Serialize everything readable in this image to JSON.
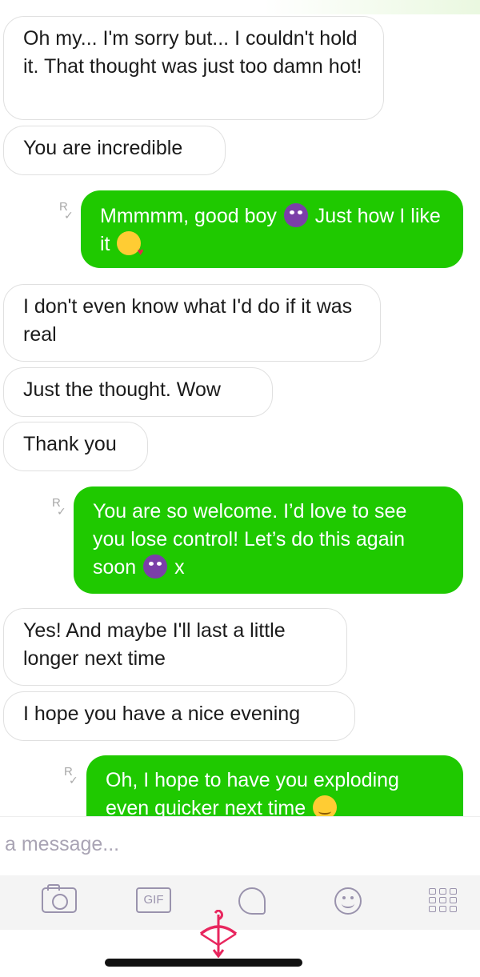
{
  "messages": [
    {
      "direction": "in",
      "text": "Oh my... I'm sorry but... I couldn't hold it. That thought was just too damn hot!"
    },
    {
      "direction": "in",
      "text": "You are incredible"
    },
    {
      "direction": "out",
      "text_1": "Mmmmm, good boy",
      "emoji_1": "smiling-devil-emoji",
      "text_2": "Just how I like it",
      "emoji_2": "kissing-face-emoji",
      "read_receipt": "R"
    },
    {
      "direction": "in",
      "text": "I don't even know what I'd do if it was real"
    },
    {
      "direction": "in",
      "text": "Just the thought. Wow"
    },
    {
      "direction": "in",
      "text": "Thank you"
    },
    {
      "direction": "out",
      "text_1": "You are so welcome. I’d love to see you lose control!  Let’s do this again soon",
      "emoji_1": "smiling-devil-emoji",
      "text_2": "x",
      "read_receipt": "R"
    },
    {
      "direction": "in",
      "text": "Yes! And maybe I'll last a little longer next time"
    },
    {
      "direction": "in",
      "text": "I hope you have a nice evening"
    },
    {
      "direction": "out",
      "text_1": "Oh, I hope to have you exploding even quicker next time",
      "emoji_1": "blushing-smile-emoji",
      "read_receipt": "R"
    }
  ],
  "composer": {
    "placeholder": "a message..."
  },
  "toolbar": {
    "items": [
      "camera-icon",
      "gif-icon",
      "sticker-icon",
      "emoji-icon",
      "apps-grid-icon"
    ],
    "gif_label": "GIF"
  },
  "colors": {
    "outgoing_bubble": "#1fc900",
    "incoming_border": "#e0e0e0",
    "toolbar_icon": "#9a93ad",
    "logo": "#e8265e"
  }
}
